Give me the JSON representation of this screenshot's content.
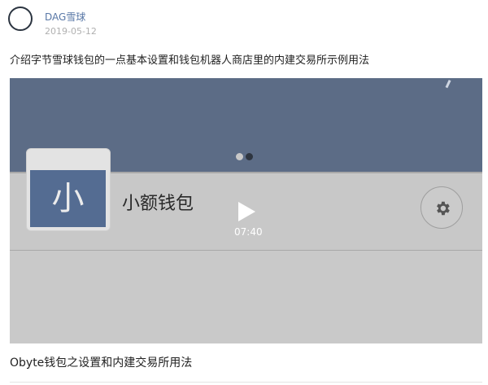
{
  "post": {
    "author": "DAG雪球",
    "date": "2019-05-12",
    "description": "介绍字节雪球钱包的一点基本设置和钱包机器人商店里的内建交易所示例用法"
  },
  "video": {
    "thumbnail": {
      "icon_char": "小",
      "wallet_name": "小额钱包",
      "icons": [
        "settings-gear-icon",
        "play-icon"
      ]
    },
    "duration": "07:40",
    "title": "Obyte钱包之设置和内建交易所用法"
  },
  "colors": {
    "author_link": "#5877a6",
    "date_text": "#b0b0b0",
    "thumbnail_top": "#5c6c86",
    "thumbnail_icon_bg": "#546c92"
  }
}
